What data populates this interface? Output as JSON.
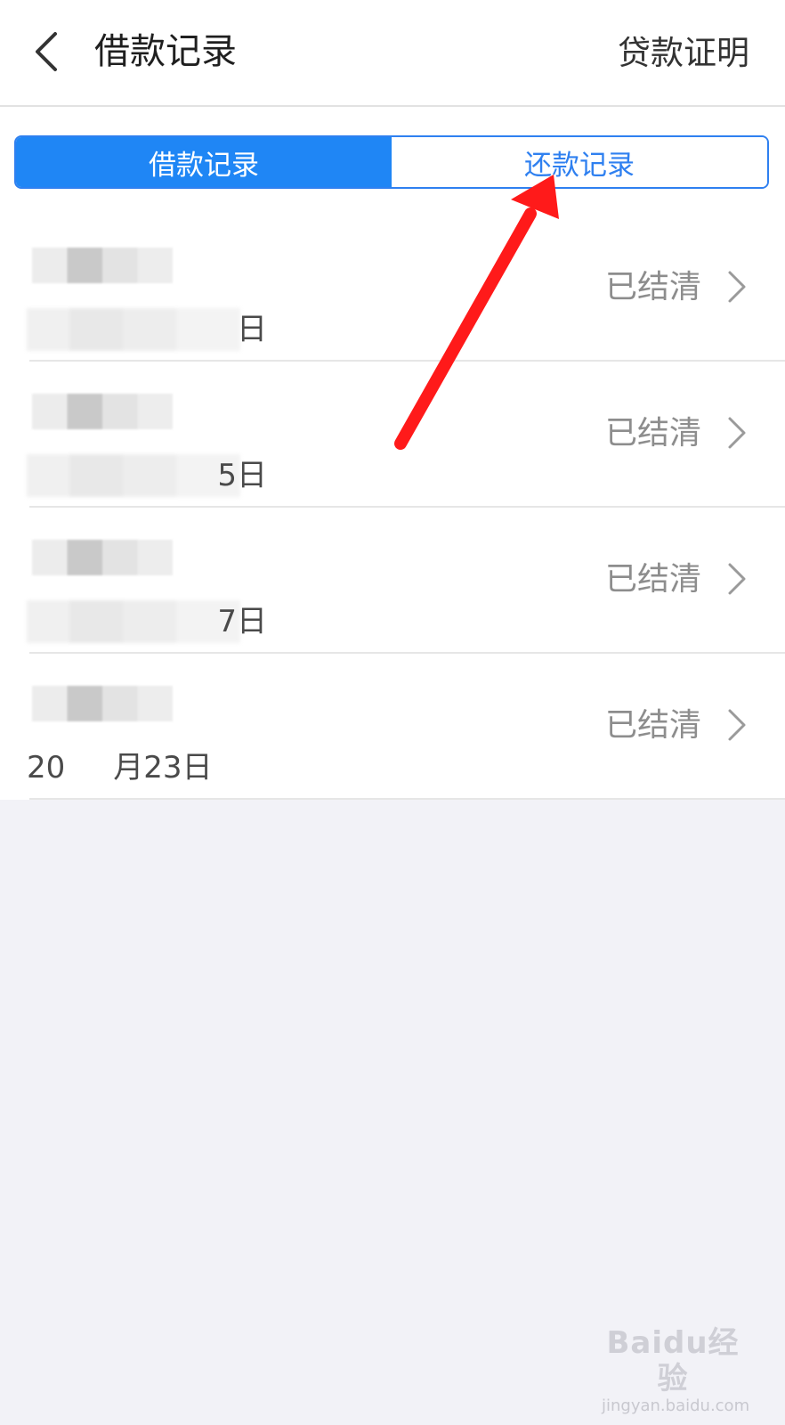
{
  "header": {
    "title": "借款记录",
    "action_label": "贷款证明"
  },
  "tabs": [
    {
      "label": "借款记录",
      "active": true
    },
    {
      "label": "还款记录",
      "active": false
    }
  ],
  "records": [
    {
      "date_visible": "日",
      "status": "已结清"
    },
    {
      "date_visible": "5日",
      "status": "已结清"
    },
    {
      "date_visible": "7日",
      "status": "已结清"
    },
    {
      "date_visible": "20     月23日",
      "status": "已结清"
    }
  ],
  "colors": {
    "accent": "#1f86f5",
    "annotation_arrow": "#ff1a1a"
  },
  "watermark": {
    "brand": "Baidu经验",
    "url": "jingyan.baidu.com"
  }
}
